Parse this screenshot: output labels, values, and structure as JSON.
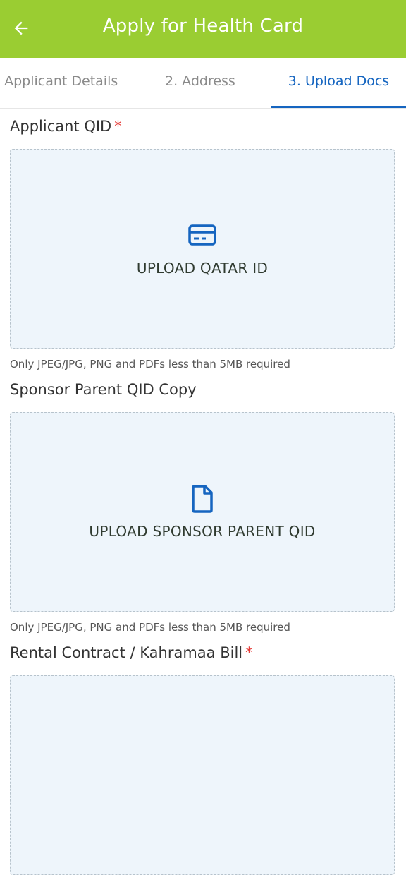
{
  "header": {
    "title": "Apply for Health Card",
    "back_icon": "arrow-left-icon"
  },
  "tabs": [
    {
      "label": ". Applicant Details",
      "active": false
    },
    {
      "label": "2. Address",
      "active": false
    },
    {
      "label": "3. Upload Docs",
      "active": true
    }
  ],
  "sections": {
    "applicant_qid": {
      "label": "Applicant QID",
      "required_mark": "*",
      "upload_label": "UPLOAD QATAR ID",
      "icon": "id-card-icon",
      "hint": "Only JPEG/JPG, PNG and PDFs less than 5MB required"
    },
    "sponsor_qid": {
      "label": "Sponsor Parent QID Copy",
      "upload_label": "UPLOAD SPONSOR PARENT QID",
      "icon": "document-icon",
      "hint": "Only JPEG/JPG, PNG and PDFs less than 5MB required"
    },
    "rental_contract": {
      "label": "Rental Contract / Kahramaa Bill",
      "required_mark": "*"
    }
  },
  "colors": {
    "app_bar": "#9acd32",
    "accent": "#1565c0",
    "required": "#e53935",
    "upload_bg": "#eef5fb"
  }
}
